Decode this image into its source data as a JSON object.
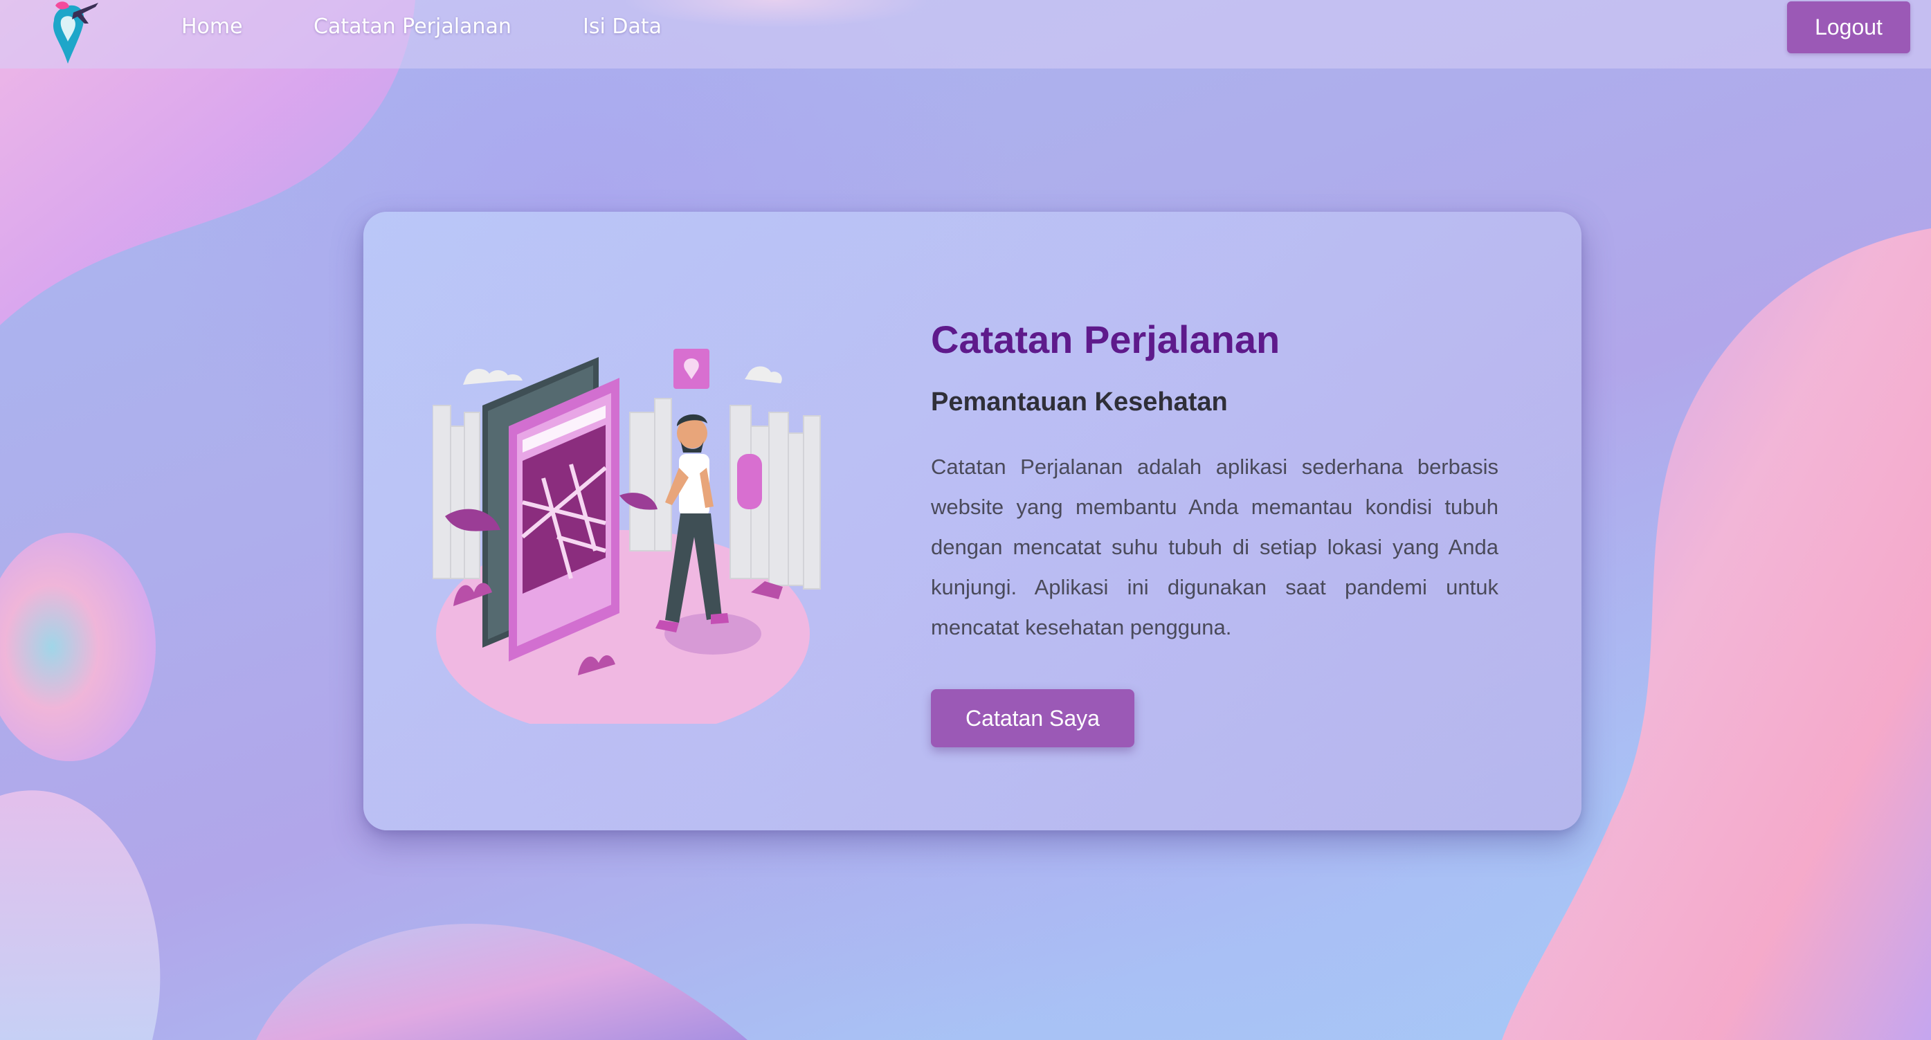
{
  "navbar": {
    "logo_icon": "travel-pin-plane-icon",
    "links": [
      {
        "label": "Home"
      },
      {
        "label": "Catatan Perjalanan"
      },
      {
        "label": "Isi Data"
      }
    ],
    "logout_label": "Logout"
  },
  "hero": {
    "illustration_icon": "traveler-map-phone-illustration",
    "title": "Catatan Perjalanan",
    "subtitle": "Pemantauan Kesehatan",
    "description": "Catatan Perjalanan adalah aplikasi sederhana berbasis website yang membantu Anda memantau kondisi tubuh dengan mencatat suhu tubuh di setiap lokasi yang Anda kunjungi. Aplikasi ini digunakan saat pandemi untuk mencatat kesehatan pengguna.",
    "button_label": "Catatan Saya"
  },
  "colors": {
    "accent": "#9b59b6",
    "title": "#5e1a8b",
    "subtitle": "#2f2f38",
    "body_text": "#4a4a5a"
  }
}
